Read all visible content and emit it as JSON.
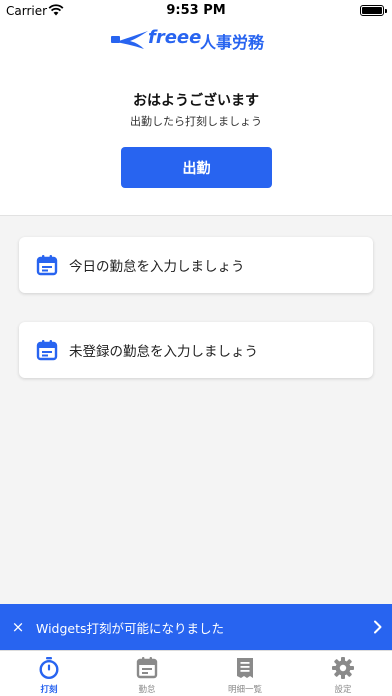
{
  "status_bar": {
    "carrier": "Carrier",
    "time": "9:53 PM"
  },
  "header": {
    "logo_text": "freee",
    "logo_ja": "人事労務"
  },
  "hero": {
    "greeting": "おはようございます",
    "subtitle": "出勤したら打刻しましょう",
    "clock_in_label": "出勤"
  },
  "cards": [
    {
      "label": "今日の勤怠を入力しましょう",
      "icon": "calendar-icon"
    },
    {
      "label": "未登録の勤怠を入力しましょう",
      "icon": "calendar-icon"
    }
  ],
  "toast": {
    "close": "×",
    "message": "Widgets打刻が可能になりました"
  },
  "tabs": [
    {
      "label": "打刻",
      "icon": "stopwatch-icon",
      "active": true
    },
    {
      "label": "勤怠",
      "icon": "calendar-icon",
      "active": false
    },
    {
      "label": "明細一覧",
      "icon": "document-icon",
      "active": false
    },
    {
      "label": "設定",
      "icon": "gear-icon",
      "active": false
    }
  ],
  "colors": {
    "accent": "#2864f0",
    "inactive": "#8a8a8a"
  }
}
